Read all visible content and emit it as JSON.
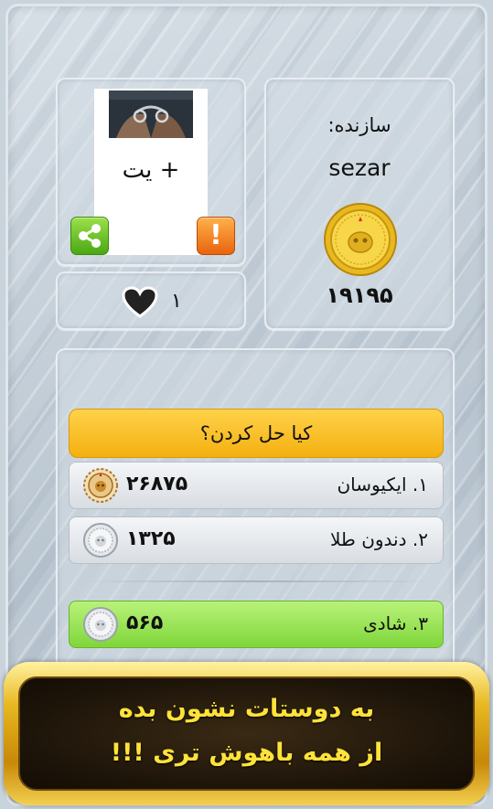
{
  "puzzle": {
    "card_text": "+ یت",
    "likes_count": "۱",
    "icons": {
      "share": "share-icon",
      "report": "exclamation-icon",
      "like": "heart-icon"
    },
    "report_glyph": "!"
  },
  "creator": {
    "label": "سازنده:",
    "name": "sezar",
    "score": "۱۹۱۹۵",
    "badge": "gold-coin-icon"
  },
  "solvers": {
    "header": "کیا حل کردن؟",
    "rows": [
      {
        "name": "۱. ایکیوسان",
        "score": "۲۶۸۷۵",
        "badge": "bronze-medal-icon"
      },
      {
        "name": "۲. دندون طلا",
        "score": "۱۳۲۵",
        "badge": "silver-coin-icon"
      },
      {
        "name": "۳. شادی",
        "score": "۵۶۵",
        "badge": "silver-coin-icon",
        "highlight": true
      }
    ]
  },
  "banner": {
    "line1": "به دوستات نشون بده",
    "line2": "از همه باهوش تری !!!"
  },
  "colors": {
    "accent_yellow": "#f4b010",
    "highlight_green": "#7fd63a",
    "share_green": "#4aa812",
    "report_orange": "#e8640e",
    "banner_text": "#ffe23a"
  }
}
